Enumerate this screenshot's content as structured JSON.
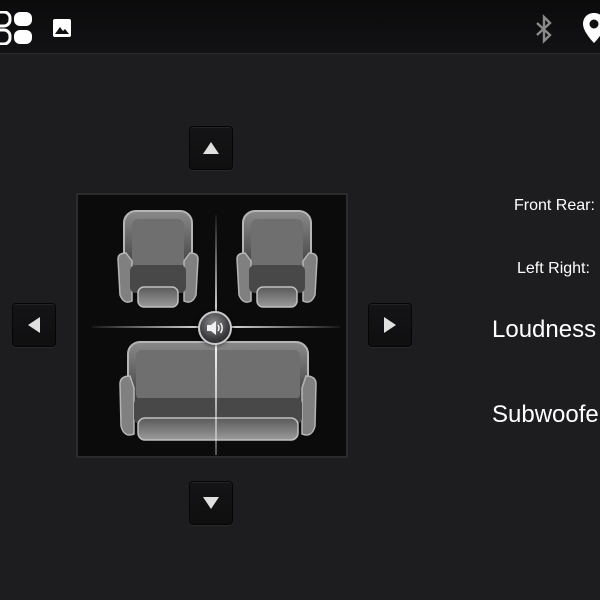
{
  "status_bar": {
    "icons": [
      "app-grid-icon",
      "gallery-icon",
      "bluetooth-icon",
      "location-pin-icon"
    ]
  },
  "balance": {
    "icons": [
      "up-arrow-icon",
      "down-arrow-icon",
      "left-arrow-icon",
      "right-arrow-icon",
      "speaker-icon"
    ],
    "seats": [
      "front-left-seat",
      "front-right-seat",
      "rear-bench-seat"
    ]
  },
  "settings": {
    "front_rear_label": "Front Rear:",
    "left_right_label": "Left Right:",
    "loudness_label": "Loudness",
    "subwoofer_label": "Subwoofe"
  },
  "colors": {
    "background": "#1d1d1f",
    "status_bar": "#0b0b0c",
    "panel": "#0b0b0c",
    "text": "#ffffff",
    "bluetooth_icon": "#8a8a8a"
  }
}
